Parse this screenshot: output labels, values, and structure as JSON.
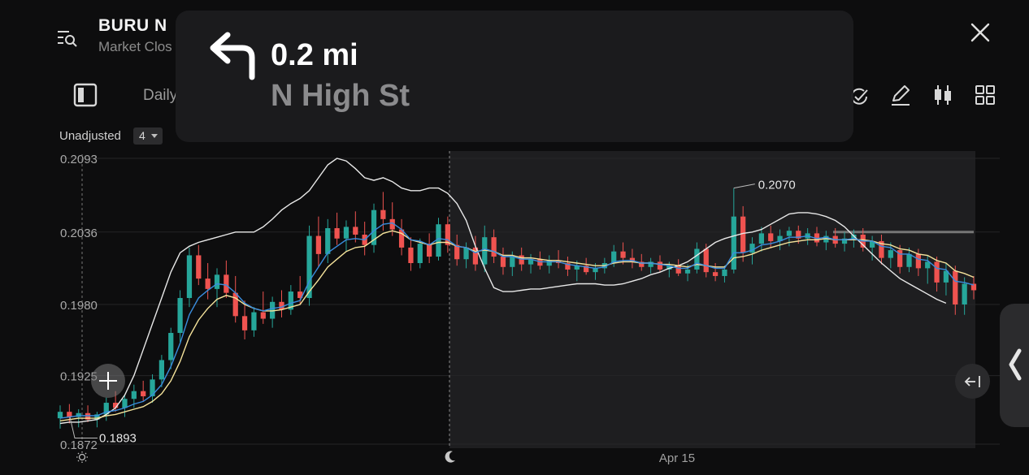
{
  "header": {
    "ticker": "BURU  N",
    "market_status": "Market Clos",
    "menu_icon": "list-search-icon",
    "close_icon": "close-icon"
  },
  "toolbar": {
    "period_label": "Daily",
    "icons": [
      "panel-toggle-icon",
      "indicator-icon",
      "draw-pen-icon",
      "candlestick-icon",
      "grid-layout-icon"
    ]
  },
  "chart_controls": {
    "adjustment_label": "Unadjusted",
    "indicator_count": "4"
  },
  "chart_data": {
    "type": "candlestick",
    "y_ticks": [
      "0.2093",
      "0.2036",
      "0.1980",
      "0.1925",
      "0.1872"
    ],
    "ylim": [
      0.1862,
      0.2101
    ],
    "x_labels": [
      "Apr 15"
    ],
    "session_icons": [
      "sun-icon",
      "moon-icon"
    ],
    "annotations": [
      {
        "label": "0.2070",
        "value": 0.207
      },
      {
        "label": "0.1893",
        "value": 0.1893
      }
    ],
    "overlay_level": 0.2036,
    "colors": {
      "up": "#26a69a",
      "down": "#ef5350",
      "ma_blue": "#3a8dde",
      "ma_yellow": "#f5e39b",
      "band_white": "#e8e8e8"
    },
    "candles": [
      [
        0.1892,
        0.1902,
        0.1884,
        0.1897
      ],
      [
        0.1897,
        0.1903,
        0.1888,
        0.1893
      ],
      [
        0.1893,
        0.1899,
        0.1885,
        0.1896
      ],
      [
        0.1896,
        0.1902,
        0.1889,
        0.1891
      ],
      [
        0.1891,
        0.1897,
        0.1885,
        0.1895
      ],
      [
        0.1895,
        0.1908,
        0.189,
        0.1904
      ],
      [
        0.1904,
        0.1913,
        0.1897,
        0.19
      ],
      [
        0.19,
        0.191,
        0.1893,
        0.1907
      ],
      [
        0.1907,
        0.1918,
        0.19,
        0.1913
      ],
      [
        0.1913,
        0.1921,
        0.1905,
        0.1909
      ],
      [
        0.1909,
        0.1926,
        0.1904,
        0.1922
      ],
      [
        0.1922,
        0.1941,
        0.1916,
        0.1937
      ],
      [
        0.1937,
        0.1962,
        0.193,
        0.1958
      ],
      [
        0.1958,
        0.1991,
        0.1951,
        0.1985
      ],
      [
        0.1985,
        0.2024,
        0.1978,
        0.2018
      ],
      [
        0.2018,
        0.2026,
        0.1995,
        0.2
      ],
      [
        0.2,
        0.2012,
        0.1984,
        0.1992
      ],
      [
        0.1992,
        0.2008,
        0.1978,
        0.2003
      ],
      [
        0.2003,
        0.2014,
        0.1985,
        0.1989
      ],
      [
        0.1989,
        0.2002,
        0.1966,
        0.1971
      ],
      [
        0.1971,
        0.1983,
        0.1953,
        0.196
      ],
      [
        0.196,
        0.1978,
        0.1955,
        0.1974
      ],
      [
        0.1974,
        0.199,
        0.1965,
        0.1969
      ],
      [
        0.1969,
        0.1986,
        0.1962,
        0.1982
      ],
      [
        0.1982,
        0.1991,
        0.197,
        0.1976
      ],
      [
        0.1976,
        0.1995,
        0.1972,
        0.199
      ],
      [
        0.199,
        0.2002,
        0.198,
        0.1985
      ],
      [
        0.1985,
        0.2041,
        0.1979,
        0.2033
      ],
      [
        0.2033,
        0.2048,
        0.2009,
        0.2019
      ],
      [
        0.2019,
        0.2046,
        0.2012,
        0.2039
      ],
      [
        0.2039,
        0.2051,
        0.2026,
        0.2031
      ],
      [
        0.2031,
        0.2045,
        0.2021,
        0.204
      ],
      [
        0.204,
        0.2052,
        0.2028,
        0.2034
      ],
      [
        0.2034,
        0.2044,
        0.2018,
        0.2026
      ],
      [
        0.2026,
        0.2058,
        0.202,
        0.2053
      ],
      [
        0.2053,
        0.2067,
        0.2037,
        0.2046
      ],
      [
        0.2046,
        0.2059,
        0.2033,
        0.2038
      ],
      [
        0.2038,
        0.2046,
        0.2018,
        0.2024
      ],
      [
        0.2024,
        0.2032,
        0.2006,
        0.2012
      ],
      [
        0.2012,
        0.2031,
        0.2008,
        0.2027
      ],
      [
        0.2027,
        0.2035,
        0.2012,
        0.2017
      ],
      [
        0.2017,
        0.2047,
        0.2014,
        0.2042
      ],
      [
        0.2042,
        0.2048,
        0.202,
        0.2026
      ],
      [
        0.2026,
        0.2034,
        0.201,
        0.2015
      ],
      [
        0.2015,
        0.2028,
        0.2008,
        0.2024
      ],
      [
        0.2024,
        0.2033,
        0.2006,
        0.2011
      ],
      [
        0.2011,
        0.2041,
        0.2005,
        0.2032
      ],
      [
        0.2032,
        0.2038,
        0.2012,
        0.2017
      ],
      [
        0.2017,
        0.2024,
        0.2003,
        0.2009
      ],
      [
        0.2009,
        0.2021,
        0.2002,
        0.2018
      ],
      [
        0.2018,
        0.2024,
        0.2006,
        0.2011
      ],
      [
        0.2011,
        0.2019,
        0.2004,
        0.2015
      ],
      [
        0.2015,
        0.2021,
        0.2007,
        0.201
      ],
      [
        0.201,
        0.2018,
        0.2004,
        0.2014
      ],
      [
        0.2014,
        0.2022,
        0.2008,
        0.2012
      ],
      [
        0.2012,
        0.2017,
        0.2002,
        0.2007
      ],
      [
        0.2007,
        0.2014,
        0.1998,
        0.201
      ],
      [
        0.201,
        0.2016,
        0.2003,
        0.2005
      ],
      [
        0.2005,
        0.2012,
        0.1999,
        0.2008
      ],
      [
        0.2008,
        0.2016,
        0.2004,
        0.2012
      ],
      [
        0.2012,
        0.2026,
        0.2009,
        0.2021
      ],
      [
        0.2021,
        0.2028,
        0.2011,
        0.2016
      ],
      [
        0.2016,
        0.2023,
        0.2008,
        0.2013
      ],
      [
        0.2013,
        0.2019,
        0.2006,
        0.2009
      ],
      [
        0.2009,
        0.2016,
        0.2004,
        0.2013
      ],
      [
        0.2013,
        0.2018,
        0.2005,
        0.2007
      ],
      [
        0.2007,
        0.2013,
        0.2001,
        0.201
      ],
      [
        0.201,
        0.2015,
        0.2002,
        0.2004
      ],
      [
        0.2004,
        0.2011,
        0.1998,
        0.2007
      ],
      [
        0.2007,
        0.2028,
        0.2004,
        0.2023
      ],
      [
        0.2023,
        0.2027,
        0.2001,
        0.2005
      ],
      [
        0.2005,
        0.2012,
        0.1998,
        0.2002
      ],
      [
        0.2002,
        0.201,
        0.1997,
        0.2007
      ],
      [
        0.2007,
        0.207,
        0.2004,
        0.2048
      ],
      [
        0.2048,
        0.2056,
        0.2013,
        0.202
      ],
      [
        0.202,
        0.2032,
        0.2011,
        0.2027
      ],
      [
        0.2027,
        0.204,
        0.2021,
        0.2035
      ],
      [
        0.2035,
        0.2041,
        0.2024,
        0.2029
      ],
      [
        0.2029,
        0.2038,
        0.2022,
        0.2033
      ],
      [
        0.2033,
        0.204,
        0.2025,
        0.2037
      ],
      [
        0.2037,
        0.2041,
        0.2027,
        0.2031
      ],
      [
        0.2031,
        0.2039,
        0.2026,
        0.2035
      ],
      [
        0.2035,
        0.204,
        0.2025,
        0.2028
      ],
      [
        0.2028,
        0.2037,
        0.2022,
        0.2033
      ],
      [
        0.2033,
        0.2039,
        0.2024,
        0.2027
      ],
      [
        0.2027,
        0.2036,
        0.2021,
        0.2031
      ],
      [
        0.2031,
        0.2038,
        0.2024,
        0.2034
      ],
      [
        0.2034,
        0.2039,
        0.2021,
        0.2024
      ],
      [
        0.2024,
        0.2033,
        0.2014,
        0.2029
      ],
      [
        0.2029,
        0.2034,
        0.2011,
        0.2016
      ],
      [
        0.2016,
        0.2028,
        0.2008,
        0.2022
      ],
      [
        0.2022,
        0.2026,
        0.2004,
        0.2009
      ],
      [
        0.2009,
        0.2024,
        0.2005,
        0.2019
      ],
      [
        0.2019,
        0.2023,
        0.2002,
        0.2008
      ],
      [
        0.2008,
        0.2018,
        0.1996,
        0.2013
      ],
      [
        0.2013,
        0.2017,
        0.199,
        0.1997
      ],
      [
        0.1997,
        0.2012,
        0.1987,
        0.2006
      ],
      [
        0.2006,
        0.201,
        0.1972,
        0.198
      ],
      [
        0.198,
        0.2001,
        0.1972,
        0.1996
      ],
      [
        0.1996,
        0.2002,
        0.1984,
        0.1991
      ]
    ],
    "ma_blue": [
      0.1892,
      0.1893,
      0.1894,
      0.1894,
      0.1894,
      0.1897,
      0.1898,
      0.19,
      0.1903,
      0.1905,
      0.191,
      0.1918,
      0.1932,
      0.195,
      0.1972,
      0.1985,
      0.1991,
      0.1996,
      0.1995,
      0.1989,
      0.1981,
      0.1977,
      0.1975,
      0.1977,
      0.1978,
      0.1981,
      0.1983,
      0.1998,
      0.2009,
      0.202,
      0.2025,
      0.203,
      0.2031,
      0.203,
      0.2037,
      0.2042,
      0.2043,
      0.2038,
      0.203,
      0.2029,
      0.2026,
      0.2031,
      0.203,
      0.2025,
      0.2024,
      0.202,
      0.2023,
      0.2021,
      0.2017,
      0.2017,
      0.2015,
      0.2015,
      0.2013,
      0.2013,
      0.2013,
      0.2011,
      0.201,
      0.2009,
      0.2008,
      0.2009,
      0.2013,
      0.2014,
      0.2014,
      0.2012,
      0.2012,
      0.2011,
      0.201,
      0.2008,
      0.2008,
      0.2012,
      0.201,
      0.2008,
      0.2008,
      0.202,
      0.202,
      0.2022,
      0.2026,
      0.2027,
      0.2029,
      0.2032,
      0.2032,
      0.2033,
      0.2031,
      0.2032,
      0.203,
      0.203,
      0.2031,
      0.2029,
      0.2029,
      0.2025,
      0.2024,
      0.2019,
      0.2019,
      0.2015,
      0.2014,
      0.2008,
      0.2007,
      0.1998,
      0.1997,
      0.1995
    ],
    "ma_yellow": [
      0.189,
      0.1891,
      0.1892,
      0.1892,
      0.1892,
      0.1894,
      0.1895,
      0.1897,
      0.1899,
      0.1901,
      0.1905,
      0.1911,
      0.1921,
      0.1936,
      0.1955,
      0.1968,
      0.1977,
      0.1984,
      0.1987,
      0.1985,
      0.198,
      0.1977,
      0.1975,
      0.1975,
      0.1976,
      0.1978,
      0.198,
      0.199,
      0.1999,
      0.2009,
      0.2015,
      0.2021,
      0.2024,
      0.2025,
      0.203,
      0.2035,
      0.2037,
      0.2035,
      0.203,
      0.2028,
      0.2026,
      0.2028,
      0.2028,
      0.2025,
      0.2024,
      0.2021,
      0.2022,
      0.2021,
      0.2018,
      0.2018,
      0.2016,
      0.2016,
      0.2015,
      0.2014,
      0.2014,
      0.2013,
      0.2012,
      0.2011,
      0.201,
      0.201,
      0.2012,
      0.2013,
      0.2013,
      0.2012,
      0.2012,
      0.2011,
      0.2011,
      0.201,
      0.2009,
      0.2011,
      0.201,
      0.2009,
      0.2009,
      0.2016,
      0.2017,
      0.2019,
      0.2022,
      0.2024,
      0.2026,
      0.2028,
      0.2029,
      0.203,
      0.203,
      0.2031,
      0.203,
      0.203,
      0.203,
      0.203,
      0.2029,
      0.2027,
      0.2026,
      0.2023,
      0.2022,
      0.2019,
      0.2018,
      0.2014,
      0.2012,
      0.2006,
      0.2004,
      0.2001
    ],
    "band_white": [
      0.1888,
      0.1889,
      0.1889,
      0.189,
      0.1891,
      0.1895,
      0.19,
      0.191,
      0.1925,
      0.1945,
      0.1965,
      0.1985,
      0.2005,
      0.202,
      0.2025,
      0.2028,
      0.203,
      0.2032,
      0.2034,
      0.2036,
      0.2036,
      0.2036,
      0.204,
      0.2046,
      0.2053,
      0.2058,
      0.2062,
      0.2068,
      0.2078,
      0.2088,
      0.2093,
      0.2091,
      0.2085,
      0.2078,
      0.2076,
      0.2078,
      0.2075,
      0.207,
      0.2068,
      0.2068,
      0.207,
      0.207,
      0.2066,
      0.2058,
      0.2045,
      0.2025,
      0.2008,
      0.1993,
      0.199,
      0.199,
      0.1991,
      0.1992,
      0.1992,
      0.1993,
      0.1994,
      0.1995,
      0.1996,
      0.1996,
      0.1996,
      0.1995,
      0.1995,
      0.1996,
      0.1998,
      0.2,
      0.2003,
      0.2005,
      0.2008,
      0.201,
      0.2013,
      0.2018,
      0.2023,
      0.2028,
      0.2031,
      0.2033,
      0.2035,
      0.2036,
      0.2038,
      0.2042,
      0.2046,
      0.205,
      0.2051,
      0.2051,
      0.205,
      0.2048,
      0.2045,
      0.204,
      0.2033,
      0.2026,
      0.2019,
      0.2012,
      0.2006,
      0.2,
      0.1996,
      0.1992,
      0.1988,
      0.1984,
      0.1981
    ]
  },
  "navigation": {
    "turn_icon": "turn-left-arrow-icon",
    "distance": "0.2 mi",
    "street": "N High St"
  },
  "controls": {
    "side_handle_icon": "chevron-left-icon",
    "collapse_icon": "collapse-left-icon",
    "crosshair_icon": "crosshair-icon"
  }
}
